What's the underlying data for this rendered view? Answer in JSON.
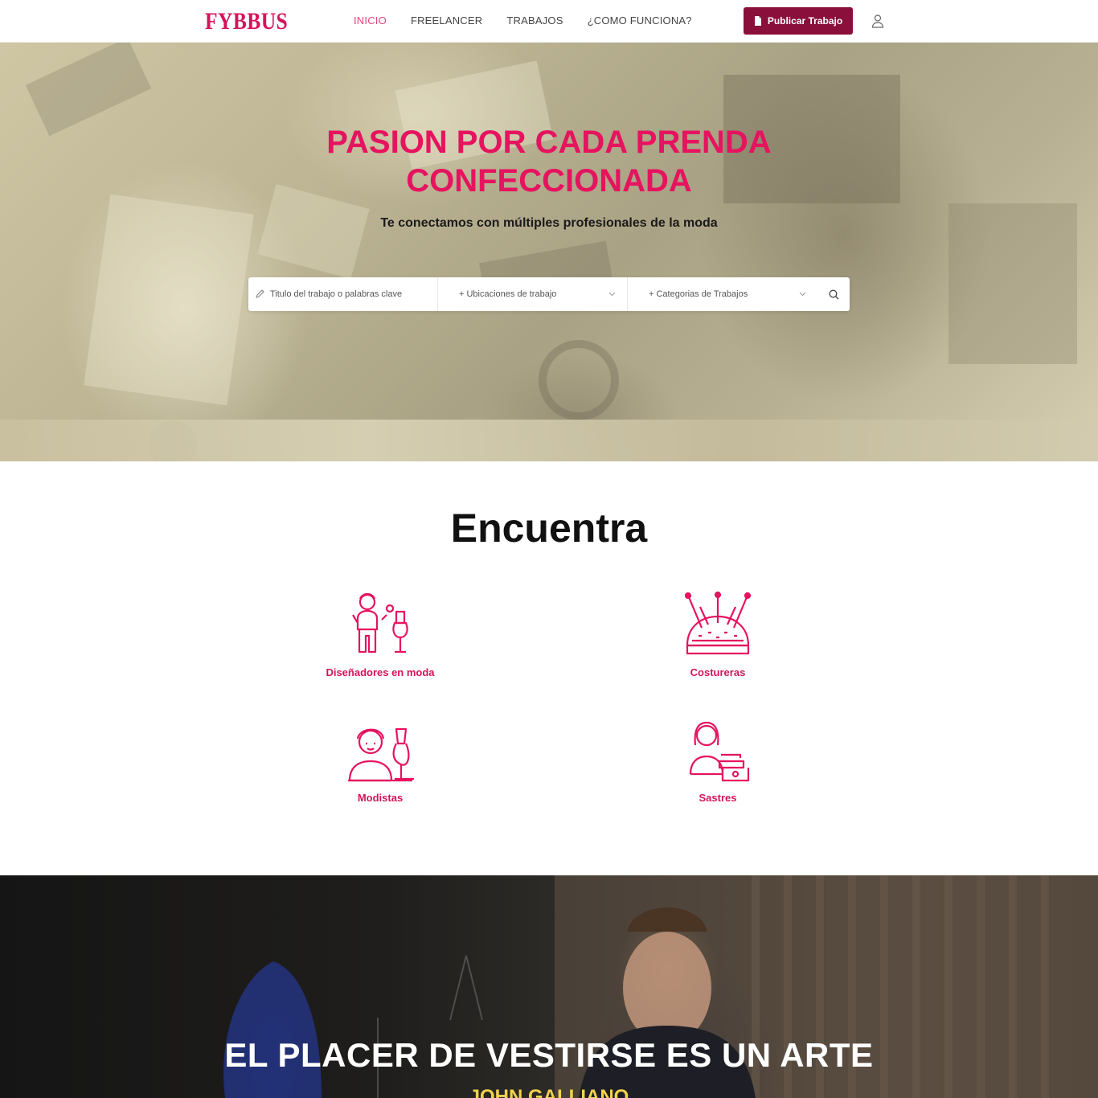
{
  "header": {
    "logo": "FYBBUS",
    "nav": [
      {
        "label": "INICIO"
      },
      {
        "label": "FREELANCER"
      },
      {
        "label": "TRABAJOS"
      },
      {
        "label": "¿COMO FUNCIONA?"
      }
    ],
    "publish_label": "Publicar Trabajo"
  },
  "hero": {
    "title_line1": "PASION POR CADA PRENDA",
    "title_line2": "CONFECCIONADA",
    "subtitle": "Te conectamos con múltiples profesionales de la moda"
  },
  "search": {
    "keyword_placeholder": "Titulo del trabajo o palabras clave",
    "location_label": "+ Ubicaciones de trabajo",
    "category_label": "+ Categorias de Trabajos"
  },
  "encuentra": {
    "title": "Encuentra",
    "categories": [
      {
        "label": "Diseñadores en moda",
        "icon": "fashion-designer-icon"
      },
      {
        "label": "Costureras",
        "icon": "pincushion-icon"
      },
      {
        "label": "Modistas",
        "icon": "dressmaker-icon"
      },
      {
        "label": "Sastres",
        "icon": "tailor-sewing-machine-icon"
      }
    ]
  },
  "quote": {
    "text": "EL PLACER DE VESTIRSE ES UN ARTE",
    "author": "JOHN GALLIANO"
  },
  "colors": {
    "brand": "#d4145a",
    "button": "#8a0f3b",
    "quote_author": "#f2d34a"
  }
}
